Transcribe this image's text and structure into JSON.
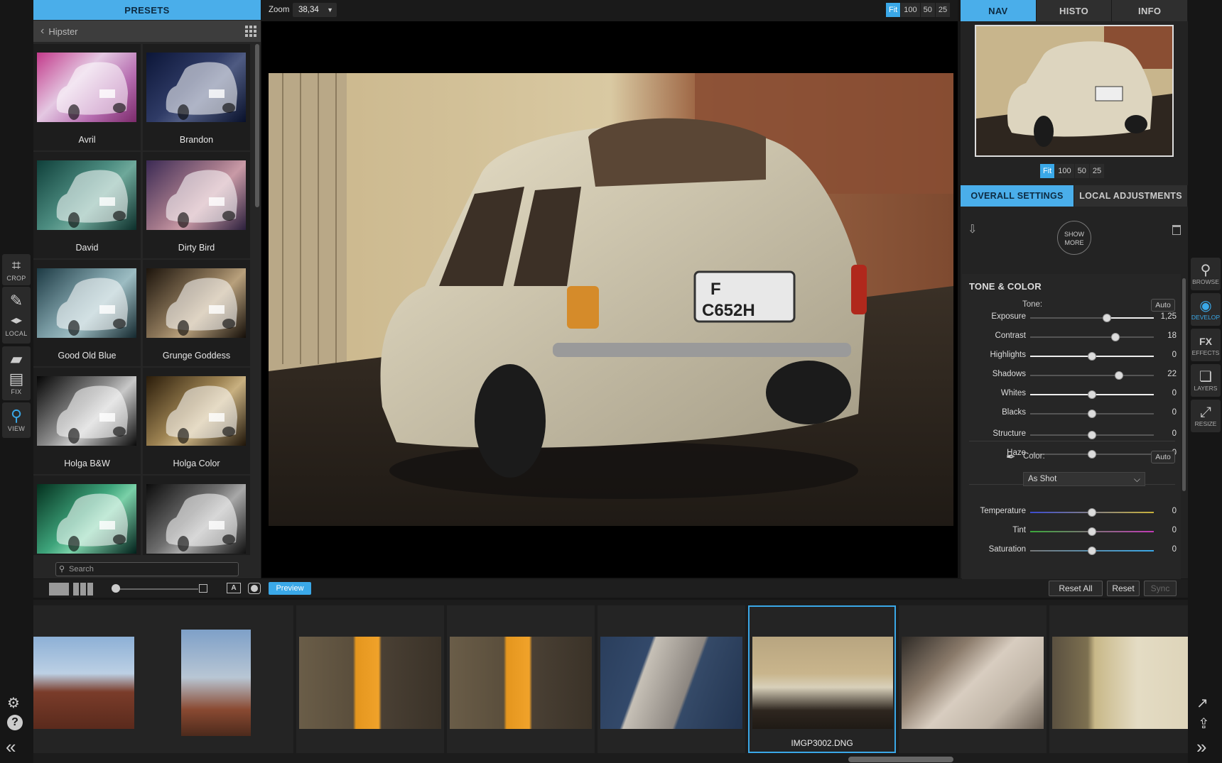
{
  "presets": {
    "header": "PRESETS",
    "breadcrumb": "Hipster",
    "items": [
      {
        "label": "Avril",
        "tone": "pink"
      },
      {
        "label": "Brandon",
        "tone": "navy"
      },
      {
        "label": "David",
        "tone": "teal"
      },
      {
        "label": "Dirty Bird",
        "tone": "mauve"
      },
      {
        "label": "Good Old Blue",
        "tone": "cyan"
      },
      {
        "label": "Grunge Goddess",
        "tone": "sepia"
      },
      {
        "label": "Holga B&W",
        "tone": "bw"
      },
      {
        "label": "Holga Color",
        "tone": "warm"
      },
      {
        "label": "",
        "tone": "green"
      },
      {
        "label": "",
        "tone": "bw2"
      }
    ],
    "search_placeholder": "Search"
  },
  "topbar": {
    "zoom_label": "Zoom",
    "zoom_value": "38,34",
    "zoom_options": [
      "Fit",
      "100",
      "50",
      "25"
    ]
  },
  "left_tools": [
    {
      "label": "CROP",
      "icon": "crop-icon"
    },
    {
      "label": "",
      "icon": "brush-icon"
    },
    {
      "label": "LOCAL",
      "icon": "local-icon"
    },
    {
      "label": "",
      "icon": "eraser-icon"
    },
    {
      "label": "FIX",
      "icon": "bandage-icon"
    },
    {
      "label": "VIEW",
      "icon": "magnifier-icon"
    }
  ],
  "right": {
    "tabs": [
      "NAV",
      "HISTO",
      "INFO"
    ],
    "nav_zoom": [
      "Fit",
      "100",
      "50",
      "25"
    ],
    "settings_tabs": [
      "OVERALL SETTINGS",
      "LOCAL ADJUSTMENTS"
    ],
    "show_more": "SHOW MORE",
    "tone": {
      "title": "TONE & COLOR",
      "tone_label": "Tone:",
      "auto": "Auto",
      "color_label": "Color:",
      "wb_value": "As Shot",
      "sliders": [
        {
          "label": "Exposure",
          "value": "1,25",
          "pos": 0.62,
          "fill": "gradient"
        },
        {
          "label": "Contrast",
          "value": "18",
          "pos": 0.69,
          "fill": "none"
        },
        {
          "label": "Highlights",
          "value": "0",
          "pos": 0.5,
          "fill": "full"
        },
        {
          "label": "Shadows",
          "value": "22",
          "pos": 0.72,
          "fill": "none"
        },
        {
          "label": "Whites",
          "value": "0",
          "pos": 0.5,
          "fill": "full"
        },
        {
          "label": "Blacks",
          "value": "0",
          "pos": 0.5,
          "fill": "none"
        },
        {
          "label": "Structure",
          "value": "0",
          "pos": 0.5,
          "fill": "none"
        },
        {
          "label": "Haze",
          "value": "0",
          "pos": 0.5,
          "fill": "none"
        },
        {
          "label": "Temperature",
          "value": "0",
          "pos": 0.5,
          "fill": "temp"
        },
        {
          "label": "Tint",
          "value": "0",
          "pos": 0.5,
          "fill": "tint"
        },
        {
          "label": "Saturation",
          "value": "0",
          "pos": 0.5,
          "fill": "sat"
        }
      ]
    }
  },
  "modules": [
    {
      "label": "BROWSE",
      "icon": "browse-icon"
    },
    {
      "label": "DEVELOP",
      "icon": "develop-icon"
    },
    {
      "label": "EFFECTS",
      "icon": "effects-icon"
    },
    {
      "label": "LAYERS",
      "icon": "layers-icon"
    },
    {
      "label": "RESIZE",
      "icon": "resize-icon"
    }
  ],
  "filmstrip_tools": {
    "preview": "Preview",
    "reset_all": "Reset All",
    "reset": "Reset",
    "sync": "Sync"
  },
  "filmstrip": {
    "selected_name": "IMGP3002.DNG"
  },
  "colors": {
    "accent": "#3aa8e8",
    "panel": "#262626",
    "background": "#161616"
  }
}
